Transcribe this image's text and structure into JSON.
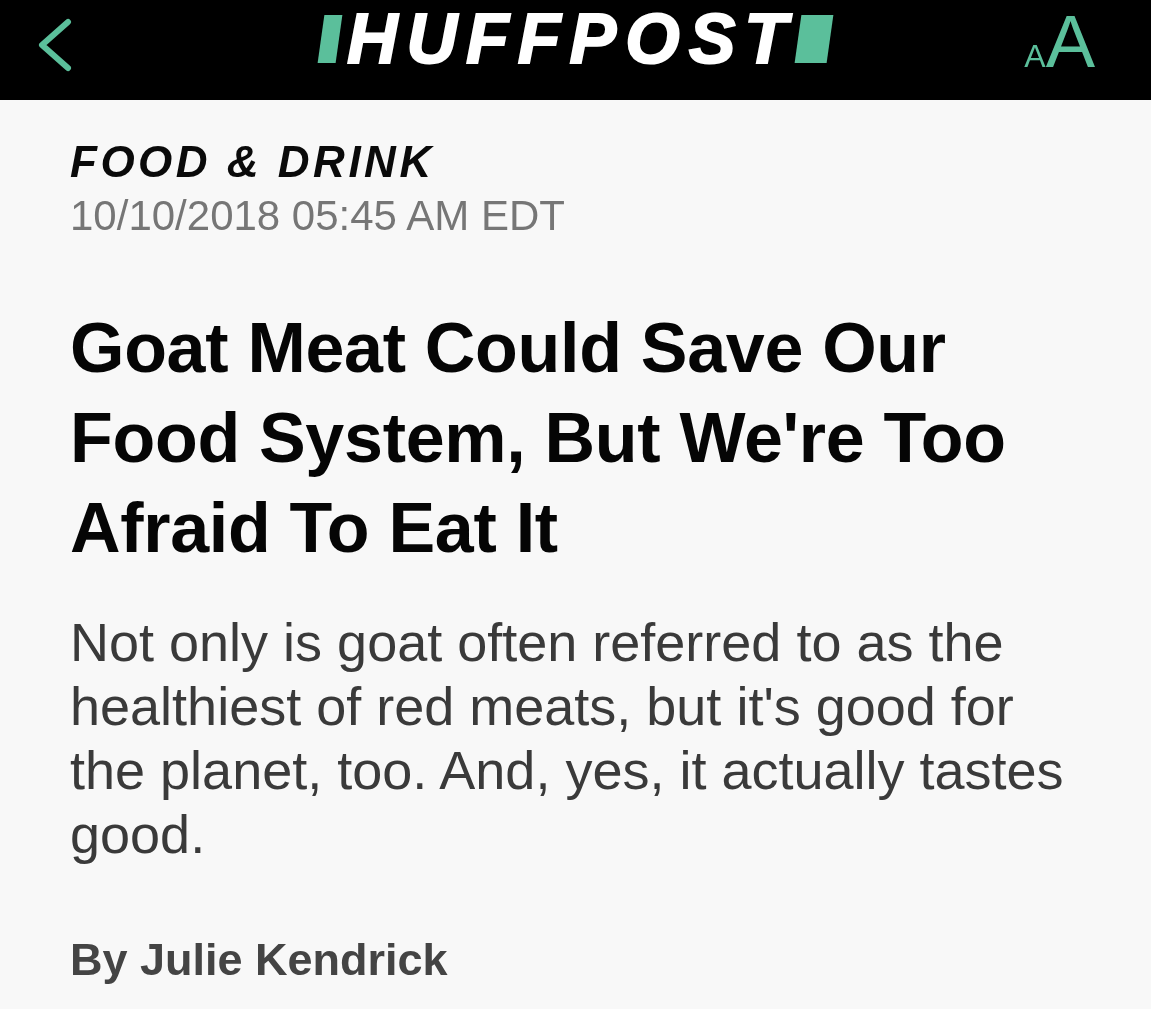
{
  "header": {
    "logo": "HUFFPOST",
    "text_size_button": {
      "small": "A",
      "large": "A"
    }
  },
  "article": {
    "section": "FOOD & DRINK",
    "timestamp": "10/10/2018 05:45 AM EDT",
    "headline": "Goat Meat Could Save Our Food System, But We're Too Afraid To Eat It",
    "summary": "Not only is goat often referred to as the healthiest of red meats, but it's good for the planet, too. And, yes, it actually tastes good.",
    "byline": "By Julie Kendrick"
  }
}
